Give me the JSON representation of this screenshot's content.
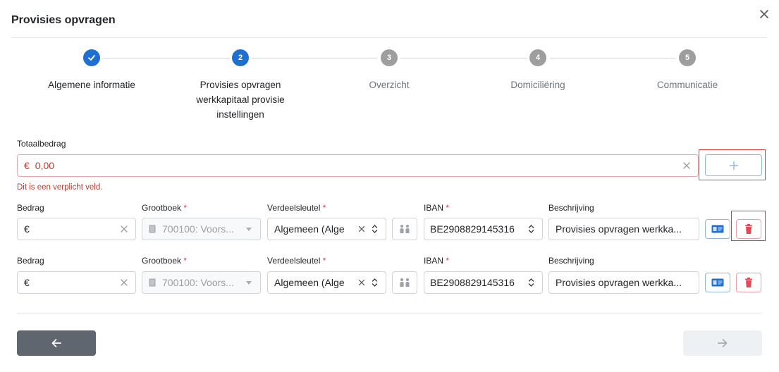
{
  "modal": {
    "title": "Provisies opvragen"
  },
  "stepper": {
    "steps": [
      {
        "number": "",
        "label": "Algemene informatie",
        "state": "done"
      },
      {
        "number": "2",
        "label": "Provisies opvragen werkkapitaal provisie instellingen",
        "state": "active"
      },
      {
        "number": "3",
        "label": "Overzicht",
        "state": "todo"
      },
      {
        "number": "4",
        "label": "Domiciliëring",
        "state": "todo"
      },
      {
        "number": "5",
        "label": "Communicatie",
        "state": "todo"
      }
    ]
  },
  "total": {
    "label": "Totaalbedrag",
    "currency": "€",
    "value": "0,00",
    "error": "Dit is een verplicht veld."
  },
  "rows": [
    {
      "labels": {
        "bedrag": "Bedrag",
        "grootboek": "Grootboek",
        "verdeelsleutel": "Verdeelsleutel",
        "iban": "IBAN",
        "beschrijving": "Beschrijving"
      },
      "required": "*",
      "bedrag_currency": "€",
      "grootboek_value": "700100: Voors...",
      "verdeelsleutel_value": "Algemeen (Alge",
      "iban_value": "BE2908829145316",
      "beschrijving_value": "Provisies opvragen werkka..."
    },
    {
      "labels": {
        "bedrag": "Bedrag",
        "grootboek": "Grootboek",
        "verdeelsleutel": "Verdeelsleutel",
        "iban": "IBAN",
        "beschrijving": "Beschrijving"
      },
      "required": "*",
      "bedrag_currency": "€",
      "grootboek_value": "700100: Voors...",
      "verdeelsleutel_value": "Algemeen (Alge",
      "iban_value": "BE2908829145316",
      "beschrijving_value": "Provisies opvragen werkka..."
    }
  ],
  "icons": {
    "close": "close-icon",
    "check": "check-icon",
    "plus": "plus-icon",
    "clear": "clear-icon",
    "ledger": "ledger-icon",
    "caret": "caret-down-icon",
    "updown": "updown-icon",
    "split": "people-icon",
    "card": "id-card-icon",
    "trash": "trash-icon",
    "back": "arrow-left-icon",
    "next": "arrow-right-icon"
  },
  "colors": {
    "primary": "#1f6fd1",
    "error": "#c0392b",
    "muted": "#9e9e9e",
    "back_button": "#5f6670"
  }
}
